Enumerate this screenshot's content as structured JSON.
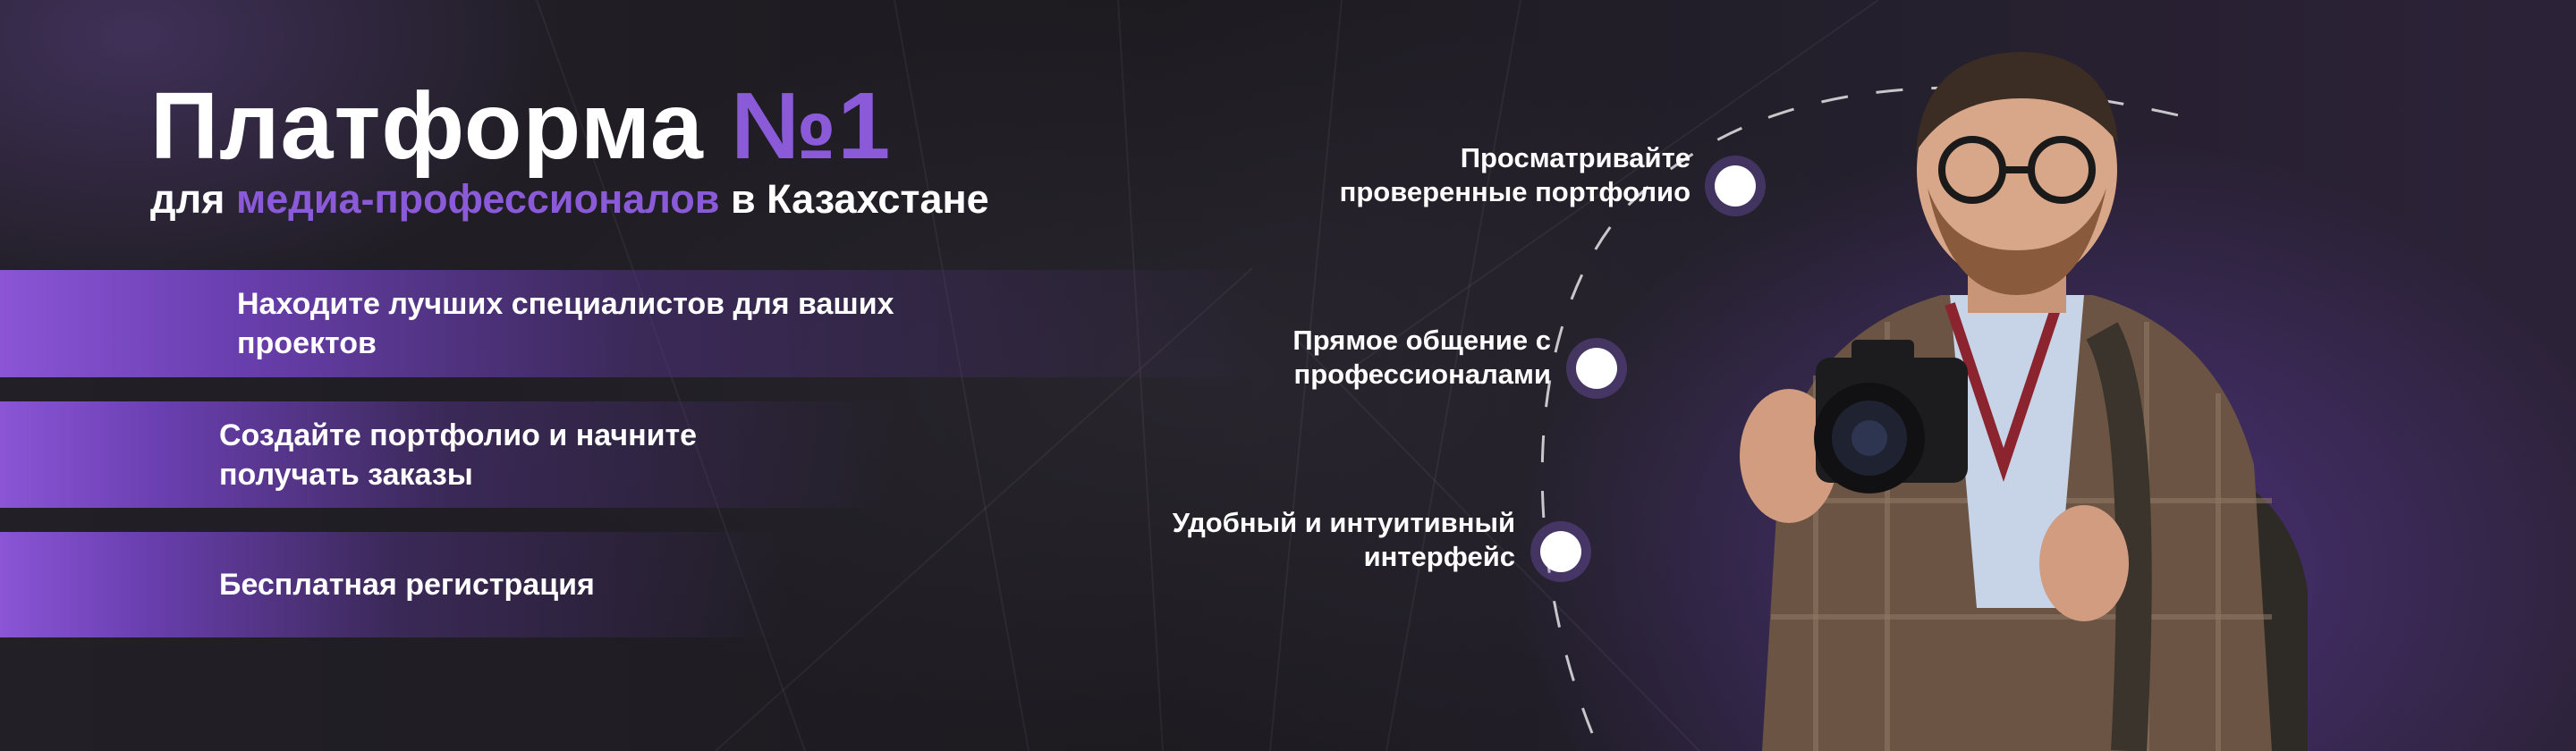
{
  "banner": {
    "title_main": "Платформа",
    "title_accent": "№1",
    "subtitle_pre": "для",
    "subtitle_accent": "медиа-профессионалов",
    "subtitle_post": "в Казахстане"
  },
  "benefits": [
    {
      "label": "Находите лучших специалистов для ваших\nпроектов"
    },
    {
      "label": "Создайте портфолио и начните\nполучать заказы"
    },
    {
      "label": "Бесплатная регистрация"
    }
  ],
  "features": [
    {
      "label": "Просматривайте\nпроверенные портфолио"
    },
    {
      "label": "Прямое общение с\nпрофессионалами"
    },
    {
      "label": "Удобный и интуитивный\nинтерфейс"
    }
  ],
  "colors": {
    "accent": "#8a5ad9",
    "background": "#1d1b20",
    "band_start": "#8b55d6"
  }
}
